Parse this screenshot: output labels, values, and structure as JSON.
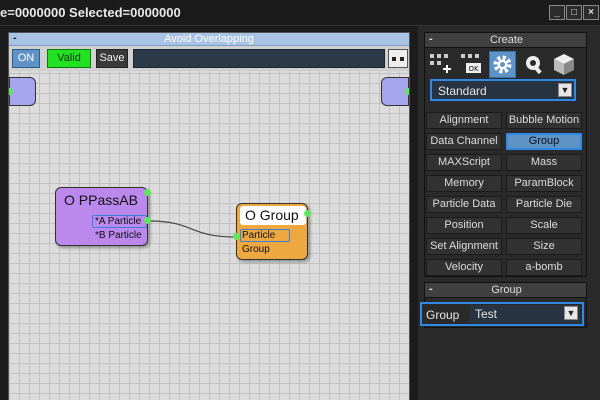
{
  "window": {
    "title": "e=0000000  Selected=0000000",
    "buttons": {
      "minimize": "_",
      "restore": "□",
      "close": "×"
    }
  },
  "canvas": {
    "collapse": "-",
    "title": "Avoid Overlapping",
    "toolbar": {
      "on": "ON",
      "valid": "Valid",
      "save": "Save"
    }
  },
  "nodes": {
    "ppass": {
      "title": "O PPassAB",
      "ports": [
        "*A Particle",
        "*B Particle"
      ]
    },
    "group": {
      "title": "O Group",
      "ports": [
        "Particle",
        "Group"
      ]
    }
  },
  "create_rollout": {
    "collapse": "-",
    "title": "Create",
    "icons": [
      "create-particles-icon",
      "create-ok-icon",
      "gear-icon",
      "wrench-icon",
      "cube-icon"
    ],
    "category": "Standard",
    "buttons": [
      "Alignment",
      "Bubble Motion",
      "Data Channel",
      "Group",
      "MAXScript",
      "Mass",
      "Memory",
      "ParamBlock",
      "Particle Data",
      "Particle Die",
      "Position",
      "Scale",
      "Set Alignment",
      "Size",
      "Velocity",
      "a-bomb"
    ],
    "active_button": "Group"
  },
  "group_rollout": {
    "collapse": "-",
    "title": "Group",
    "label": "Group",
    "value": "Test"
  },
  "colors": {
    "accent": "#2e8ae6",
    "active_fill": "#5f93c6",
    "valid_green": "#22e022",
    "node_purple": "#bb88ee",
    "node_orange": "#eda840",
    "port_green": "#5fe65f"
  }
}
